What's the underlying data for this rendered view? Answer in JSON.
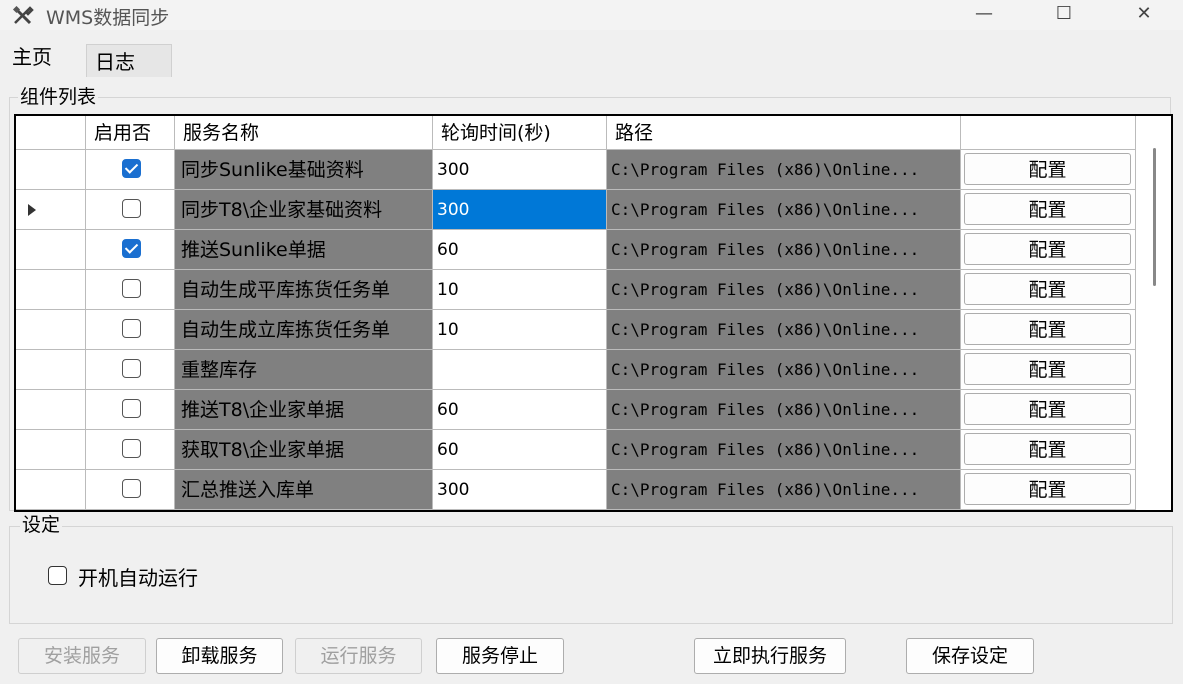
{
  "window": {
    "title": "WMS数据同步",
    "minimize": "—",
    "maximize": "☐",
    "close": "✕"
  },
  "tabs": [
    {
      "label": "主页",
      "active": true
    },
    {
      "label": "日志",
      "active": false
    }
  ],
  "component_group": {
    "label": "组件列表"
  },
  "grid": {
    "headers": {
      "enabled": "启用否",
      "name": "服务名称",
      "poll": "轮询时间(秒)",
      "path": "路径",
      "config": ""
    },
    "rows": [
      {
        "enabled": true,
        "name": "同步Sunlike基础资料",
        "poll": "300",
        "path": "C:\\Program Files (x86)\\Online...",
        "config": "配置",
        "current": false,
        "poll_selected": false
      },
      {
        "enabled": false,
        "name": "同步T8\\企业家基础资料",
        "poll": "300",
        "path": "C:\\Program Files (x86)\\Online...",
        "config": "配置",
        "current": true,
        "poll_selected": true
      },
      {
        "enabled": true,
        "name": "推送Sunlike单据",
        "poll": "60",
        "path": "C:\\Program Files (x86)\\Online...",
        "config": "配置",
        "current": false,
        "poll_selected": false
      },
      {
        "enabled": false,
        "name": "自动生成平库拣货任务单",
        "poll": "10",
        "path": "C:\\Program Files (x86)\\Online...",
        "config": "配置",
        "current": false,
        "poll_selected": false
      },
      {
        "enabled": false,
        "name": "自动生成立库拣货任务单",
        "poll": "10",
        "path": "C:\\Program Files (x86)\\Online...",
        "config": "配置",
        "current": false,
        "poll_selected": false
      },
      {
        "enabled": false,
        "name": "重整库存",
        "poll": "",
        "path": "C:\\Program Files (x86)\\Online...",
        "config": "配置",
        "current": false,
        "poll_selected": false
      },
      {
        "enabled": false,
        "name": "推送T8\\企业家单据",
        "poll": "60",
        "path": "C:\\Program Files (x86)\\Online...",
        "config": "配置",
        "current": false,
        "poll_selected": false
      },
      {
        "enabled": false,
        "name": "获取T8\\企业家单据",
        "poll": "60",
        "path": "C:\\Program Files (x86)\\Online...",
        "config": "配置",
        "current": false,
        "poll_selected": false
      },
      {
        "enabled": false,
        "name": "汇总推送入库单",
        "poll": "300",
        "path": "C:\\Program Files (x86)\\Online...",
        "config": "配置",
        "current": false,
        "poll_selected": false
      }
    ]
  },
  "settings": {
    "label": "设定",
    "auto_start_label": "开机自动运行",
    "auto_start_checked": false
  },
  "buttons": {
    "install": "安装服务",
    "uninstall": "卸载服务",
    "run": "运行服务",
    "stop": "服务停止",
    "execute_now": "立即执行服务",
    "save": "保存设定"
  },
  "colors": {
    "selection": "#0078d7",
    "readonly_cell": "#808080",
    "checkbox_checked": "#1a6fd0"
  }
}
